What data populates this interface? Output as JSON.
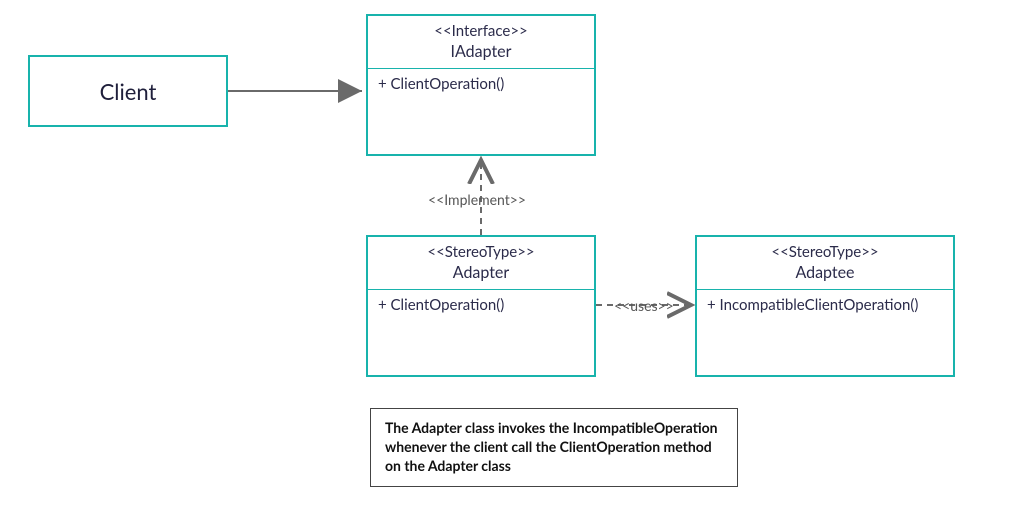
{
  "colors": {
    "border": "#18b3ac",
    "text": "#2b2b4a",
    "line": "#6a6a6a"
  },
  "client": {
    "label": "Client"
  },
  "iadapter": {
    "stereotype": "<<Interface>>",
    "name": "IAdapter",
    "op": "+ ClientOperation()"
  },
  "adapter": {
    "stereotype": "<<StereoType>>",
    "name": "Adapter",
    "op": "+ ClientOperation()"
  },
  "adaptee": {
    "stereotype": "<<StereoType>>",
    "name": "Adaptee",
    "op": "+ IncompatibleClientOperation()"
  },
  "rel": {
    "implement": "<<Implement>>",
    "uses": "<<uses>>"
  },
  "note": "The Adapter class invokes the IncompatibleOperation whenever the client call the ClientOperation method on the Adapter class"
}
